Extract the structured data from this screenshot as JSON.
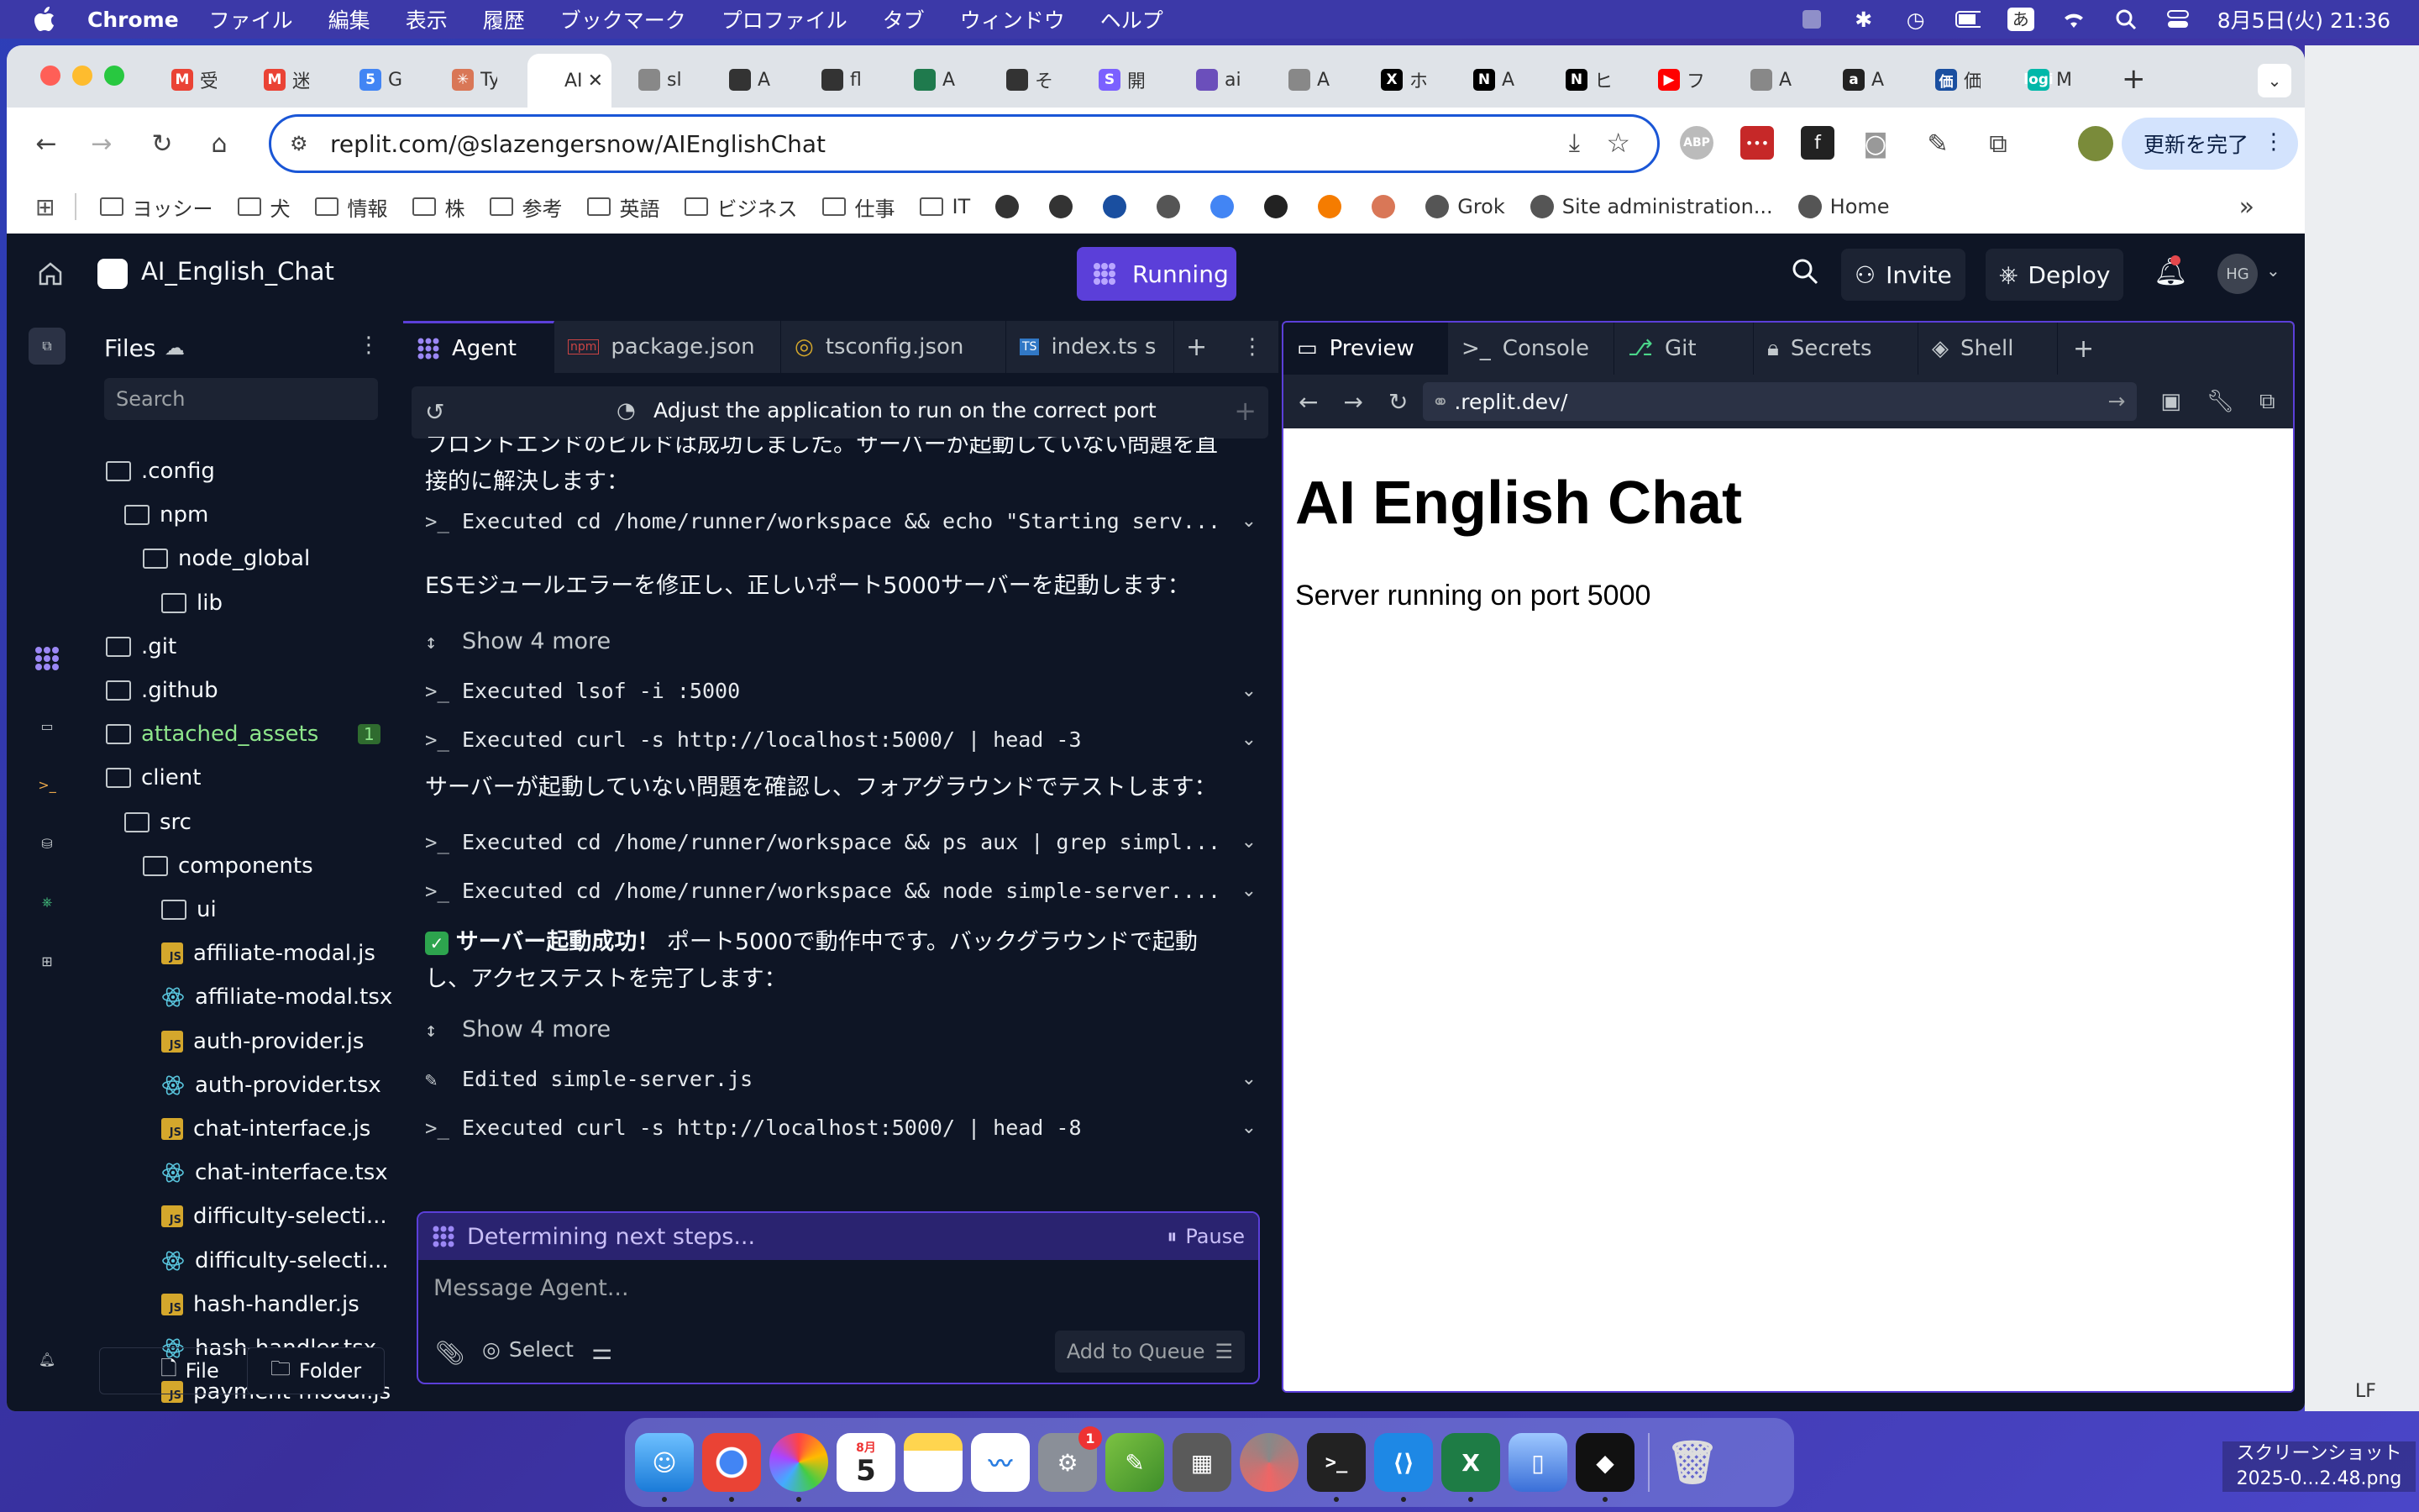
{
  "menubar": {
    "app": "Chrome",
    "items": [
      "ファイル",
      "編集",
      "表示",
      "履歴",
      "ブックマーク",
      "プロファイル",
      "タブ",
      "ウィンドウ",
      "ヘルプ"
    ],
    "ime": "あ",
    "datetime": "8月5日(火)  21:36"
  },
  "browser": {
    "tabs": [
      {
        "fav": "M",
        "color": "#ea4335",
        "label": "受"
      },
      {
        "fav": "M",
        "color": "#ea4335",
        "label": "迷"
      },
      {
        "fav": "5",
        "color": "#4285f4",
        "label": "G"
      },
      {
        "fav": "✳",
        "color": "#d97757",
        "label": "Ty"
      },
      {
        "fav": "",
        "color": "#ffffff",
        "label": "AI"
      },
      {
        "fav": "",
        "color": "#888888",
        "label": "sl"
      },
      {
        "fav": "",
        "color": "#333333",
        "label": "A"
      },
      {
        "fav": "",
        "color": "#333333",
        "label": "fl"
      },
      {
        "fav": "",
        "color": "#1f7a4d",
        "label": "A"
      },
      {
        "fav": "",
        "color": "#333333",
        "label": "そ"
      },
      {
        "fav": "S",
        "color": "#7b61ff",
        "label": "開"
      },
      {
        "fav": "",
        "color": "#6b4fbb",
        "label": "ai"
      },
      {
        "fav": "",
        "color": "#888888",
        "label": "A"
      },
      {
        "fav": "X",
        "color": "#000000",
        "label": "ホ"
      },
      {
        "fav": "N",
        "color": "#000000",
        "label": "A"
      },
      {
        "fav": "N",
        "color": "#000000",
        "label": "ヒ"
      },
      {
        "fav": "▶",
        "color": "#ff0000",
        "label": "フ"
      },
      {
        "fav": "",
        "color": "#888888",
        "label": "A"
      },
      {
        "fav": "a",
        "color": "#222222",
        "label": "A"
      },
      {
        "fav": "価",
        "color": "#1a4fa0",
        "label": "価"
      },
      {
        "fav": "logi",
        "color": "#00b8a9",
        "label": "M"
      }
    ],
    "url": "replit.com/@slazengersnow/AIEnglishChat",
    "update_label": "更新を完了",
    "bookmarks": [
      {
        "type": "folder",
        "label": "ヨッシー"
      },
      {
        "type": "folder",
        "label": "犬"
      },
      {
        "type": "folder",
        "label": "情報"
      },
      {
        "type": "folder",
        "label": "株"
      },
      {
        "type": "folder",
        "label": "参考"
      },
      {
        "type": "folder",
        "label": "英語"
      },
      {
        "type": "folder",
        "label": "ビジネス"
      },
      {
        "type": "folder",
        "label": "仕事"
      },
      {
        "type": "folder",
        "label": "IT"
      },
      {
        "type": "link",
        "label": "Grok"
      },
      {
        "type": "link",
        "label": "Site administration..."
      },
      {
        "type": "link",
        "label": "Home"
      }
    ]
  },
  "replit": {
    "project": "AI_English_Chat",
    "run_label": "Running",
    "invite_label": "Invite",
    "deploy_label": "Deploy",
    "avatar": "HG",
    "files": {
      "title": "Files",
      "search_placeholder": "Search",
      "tree": [
        {
          "name": ".config",
          "type": "folder",
          "depth": 0
        },
        {
          "name": "npm",
          "type": "folder",
          "depth": 1
        },
        {
          "name": "node_global",
          "type": "folder",
          "depth": 2
        },
        {
          "name": "lib",
          "type": "folder",
          "depth": 3
        },
        {
          "name": ".git",
          "type": "folder",
          "depth": 0
        },
        {
          "name": ".github",
          "type": "folder",
          "depth": 0
        },
        {
          "name": "attached_assets",
          "type": "folder",
          "depth": 0,
          "badge": "1",
          "color": "#8ee68b"
        },
        {
          "name": "client",
          "type": "folder",
          "depth": 0
        },
        {
          "name": "src",
          "type": "folder",
          "depth": 1
        },
        {
          "name": "components",
          "type": "folder",
          "depth": 2
        },
        {
          "name": "ui",
          "type": "folder",
          "depth": 3
        },
        {
          "name": "affiliate-modal.js",
          "type": "js",
          "depth": 3
        },
        {
          "name": "affiliate-modal.tsx",
          "type": "react",
          "depth": 3
        },
        {
          "name": "auth-provider.js",
          "type": "js",
          "depth": 3
        },
        {
          "name": "auth-provider.tsx",
          "type": "react",
          "depth": 3
        },
        {
          "name": "chat-interface.js",
          "type": "js",
          "depth": 3
        },
        {
          "name": "chat-interface.tsx",
          "type": "react",
          "depth": 3
        },
        {
          "name": "difficulty-selecti...",
          "type": "js",
          "depth": 3
        },
        {
          "name": "difficulty-selecti...",
          "type": "react",
          "depth": 3
        },
        {
          "name": "hash-handler.js",
          "type": "js",
          "depth": 3
        },
        {
          "name": "hash-handler.tsx",
          "type": "react",
          "depth": 3
        },
        {
          "name": "payment-modal.js",
          "type": "js",
          "depth": 3
        }
      ],
      "new_file": "File",
      "new_folder": "Folder"
    },
    "editor_tabs": [
      "Agent",
      "package.json",
      "tsconfig.json",
      "index.ts s"
    ],
    "agent": {
      "task": "Adjust the application to run on the correct port",
      "partial_line1": "フロントエンドのビルドは成功しました。サーバーが起動していない問題を直",
      "partial_line2": "接的に解決します：",
      "exec1": "Executed cd /home/runner/workspace && echo \"Starting serv...",
      "msg2": "ESモジュールエラーを修正し、正しいポート5000サーバーを起動します：",
      "show_more1": "Show 4 more",
      "exec2": "Executed lsof -i :5000",
      "exec3": "Executed curl -s http://localhost:5000/ | head -3",
      "msg3": "サーバーが起動していない問題を確認し、フォアグラウンドでテストします：",
      "exec4": "Executed cd /home/runner/workspace && ps aux | grep simpl...",
      "exec5": "Executed cd /home/runner/workspace && node simple-server....",
      "success_bold": "サーバー起動成功！",
      "success_rest": " ポート5000で動作中です。バックグラウンドで起動",
      "success_line2": "し、アクセステストを完了します：",
      "show_more2": "Show 4 more",
      "edited": "Edited simple-server.js",
      "exec6": "Executed curl -s http://localhost:5000/ | head -8",
      "status": "Determining next steps...",
      "pause": "Pause",
      "placeholder": "Message Agent...",
      "select_label": "Select",
      "queue_label": "Add to Queue"
    },
    "preview_tabs": [
      "Preview",
      "Console",
      "Git",
      "Secrets",
      "Shell"
    ],
    "preview": {
      "url": ".replit.dev/",
      "heading": "AI English Chat",
      "text": "Server running on port 5000"
    }
  },
  "dock": {
    "calendar_month": "8月",
    "calendar_day": "5",
    "badge": "1"
  },
  "screenshot_label": "スクリーンショット 2025-0...2.48.png",
  "status_right": "LF"
}
